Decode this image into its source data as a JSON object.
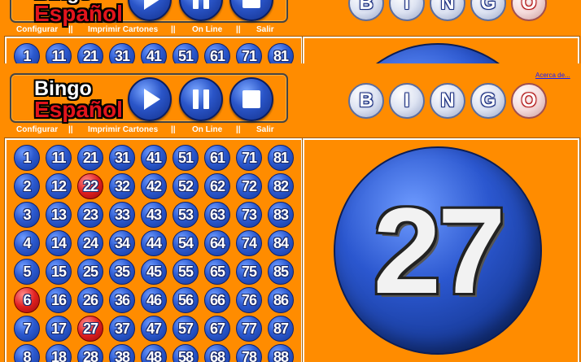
{
  "logo": {
    "line1": "Bingo",
    "line2": "Español"
  },
  "controls": {
    "play": "play-icon",
    "pause": "pause-icon",
    "stop": "stop-icon"
  },
  "menu": {
    "items": [
      "Configurar",
      "Imprimir Cartones",
      "On Line",
      "Salir"
    ],
    "separator": "||"
  },
  "title_balls": [
    "B",
    "I",
    "N",
    "G",
    "O"
  ],
  "about_link": "Acerca de...",
  "current_number": "27",
  "colors": {
    "background": "#ff8c00",
    "ball_blue": "#2c5ad0",
    "ball_called": "#e02020",
    "title_letters": "#1b2f80"
  },
  "board": {
    "numbers": [
      [
        "1",
        "11",
        "21",
        "31",
        "41",
        "51",
        "61",
        "71",
        "81"
      ],
      [
        "2",
        "12",
        "22",
        "32",
        "42",
        "52",
        "62",
        "72",
        "82"
      ],
      [
        "3",
        "13",
        "23",
        "33",
        "43",
        "53",
        "63",
        "73",
        "83"
      ],
      [
        "4",
        "14",
        "24",
        "34",
        "44",
        "54",
        "64",
        "74",
        "84"
      ],
      [
        "5",
        "15",
        "25",
        "35",
        "45",
        "55",
        "65",
        "75",
        "85"
      ],
      [
        "6",
        "16",
        "26",
        "36",
        "46",
        "56",
        "66",
        "76",
        "86"
      ],
      [
        "7",
        "17",
        "27",
        "37",
        "47",
        "57",
        "67",
        "77",
        "87"
      ],
      [
        "8",
        "18",
        "28",
        "38",
        "48",
        "58",
        "68",
        "78",
        "88"
      ]
    ],
    "called": [
      "6",
      "22",
      "27"
    ]
  }
}
